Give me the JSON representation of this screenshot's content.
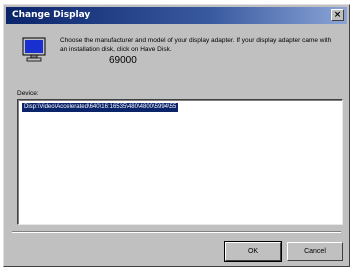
{
  "window": {
    "title": "Change Display",
    "close_glyph": "×"
  },
  "header": {
    "icon": "monitor-icon",
    "description": "Choose the manufacturer and model of your display adapter. If your display adapter came with an installation disk, click on Have Disk.",
    "floating_number": "69000"
  },
  "device_list": {
    "label": "Device:",
    "items": [
      {
        "text": "Disp:\\Video\\Accelerated\\640\\16:16535\\480\\4800\\5994\\55",
        "selected": true
      }
    ]
  },
  "buttons": {
    "ok_label": "OK",
    "cancel_label": "Cancel"
  },
  "colors": {
    "title_bar": "#0a246a",
    "dialog_face": "#c0c0c0",
    "selection": "#0a246a"
  }
}
